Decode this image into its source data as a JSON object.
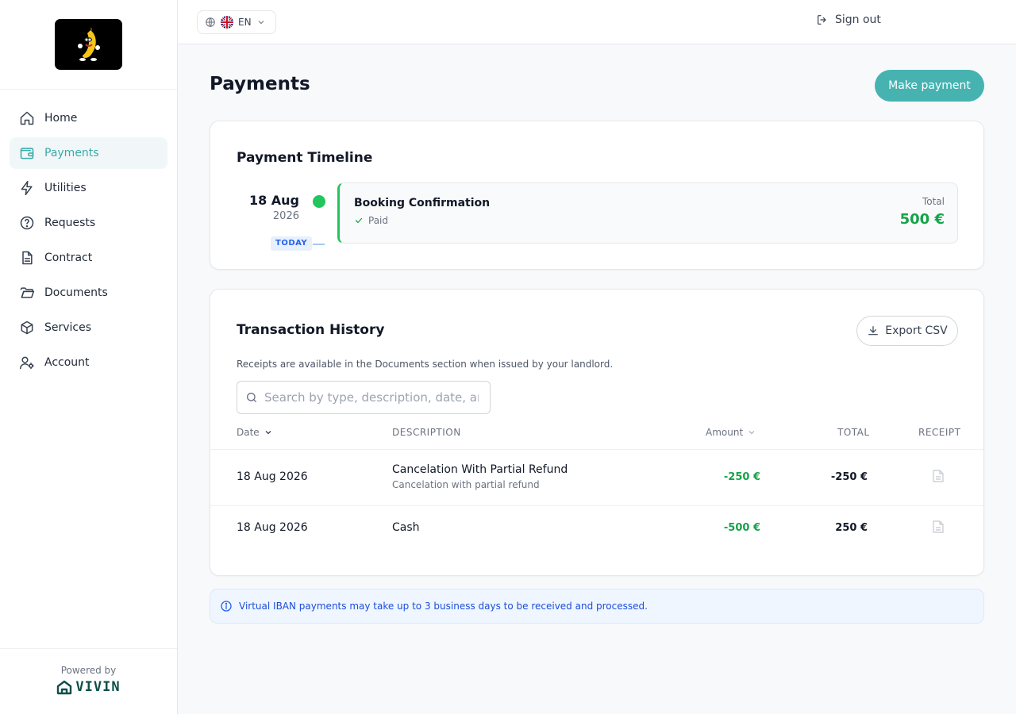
{
  "sidebar": {
    "items": [
      {
        "label": "Home",
        "icon": "home-icon"
      },
      {
        "label": "Payments",
        "icon": "wallet-icon",
        "active": true
      },
      {
        "label": "Utilities",
        "icon": "lightning-icon"
      },
      {
        "label": "Requests",
        "icon": "help-circle-icon"
      },
      {
        "label": "Contract",
        "icon": "document-icon"
      },
      {
        "label": "Documents",
        "icon": "folder-icon"
      },
      {
        "label": "Services",
        "icon": "box-icon"
      },
      {
        "label": "Account",
        "icon": "user-settings-icon"
      }
    ],
    "powered_by": "Powered by",
    "brand": "VIVIN"
  },
  "topbar": {
    "language": "EN",
    "sign_out": "Sign out"
  },
  "page": {
    "title": "Payments",
    "make_payment": "Make payment"
  },
  "timeline": {
    "title": "Payment Timeline",
    "date_day": "18 Aug",
    "date_year": "2026",
    "today_badge": "TODAY",
    "event_title": "Booking Confirmation",
    "event_status": "Paid",
    "total_label": "Total",
    "total_value": "500 €"
  },
  "history": {
    "title": "Transaction History",
    "export_label": "Export CSV",
    "hint": "Receipts are available in the Documents section when issued by your landlord.",
    "search_placeholder": "Search by type, description, date, amount…",
    "columns": {
      "date": "Date",
      "description": "DESCRIPTION",
      "amount": "Amount",
      "total": "TOTAL",
      "receipt": "RECEIPT"
    },
    "rows": [
      {
        "date": "18 Aug 2026",
        "description": "Cancelation With Partial Refund",
        "sub": "Cancelation with partial refund",
        "amount": "-250 €",
        "total": "-250 €"
      },
      {
        "date": "18 Aug 2026",
        "description": "Cash",
        "sub": "",
        "amount": "-500 €",
        "total": "250 €"
      }
    ]
  },
  "info": {
    "message": "Virtual IBAN payments may take up to 3 business days to be received and processed."
  },
  "colors": {
    "accent": "#46b3b1",
    "success": "#16a34a",
    "info": "#1d4ed8"
  }
}
